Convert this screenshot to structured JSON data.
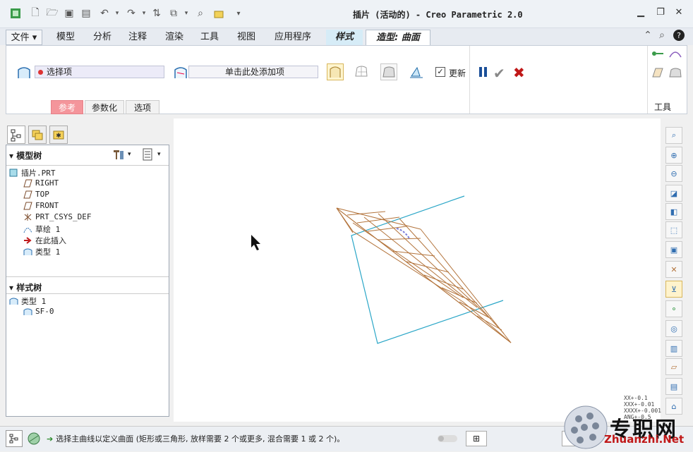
{
  "window": {
    "title": "插片 (活动的) - Creo Parametric 2.0"
  },
  "tabs": [
    {
      "label": "文件 ▾"
    },
    {
      "label": "模型"
    },
    {
      "label": "分析"
    },
    {
      "label": "注释"
    },
    {
      "label": "渲染"
    },
    {
      "label": "工具"
    },
    {
      "label": "视图"
    },
    {
      "label": "应用程序"
    },
    {
      "label": "样式"
    },
    {
      "label": "造型: 曲面"
    }
  ],
  "ribbon": {
    "select_field": "选择项",
    "add_field": "单击此处添加项",
    "update_label": "更新",
    "update_checked": true,
    "tools_label": "工具",
    "subtabs": [
      "参考",
      "参数化",
      "选项"
    ]
  },
  "model_tree": {
    "header": "模型树",
    "items": [
      "插片.PRT",
      "RIGHT",
      "TOP",
      "FRONT",
      "PRT_CSYS_DEF",
      "草绘 1",
      "在此插入",
      "类型 1"
    ]
  },
  "style_tree": {
    "header": "样式树",
    "items": [
      "类型 1",
      "SF-0"
    ]
  },
  "status": {
    "message": "选择主曲线以定义曲面 (矩形或三角形, 放样需要 2 个或更多, 混合需要 1 或 2 个)。"
  },
  "watermark": {
    "brand": "专职网",
    "url": "Zhuanzhi.Net"
  },
  "tolerances": [
    "XX+-0.1",
    "XXX+-0.01",
    "XXXX+-0.001",
    "ANG+-0.5"
  ]
}
